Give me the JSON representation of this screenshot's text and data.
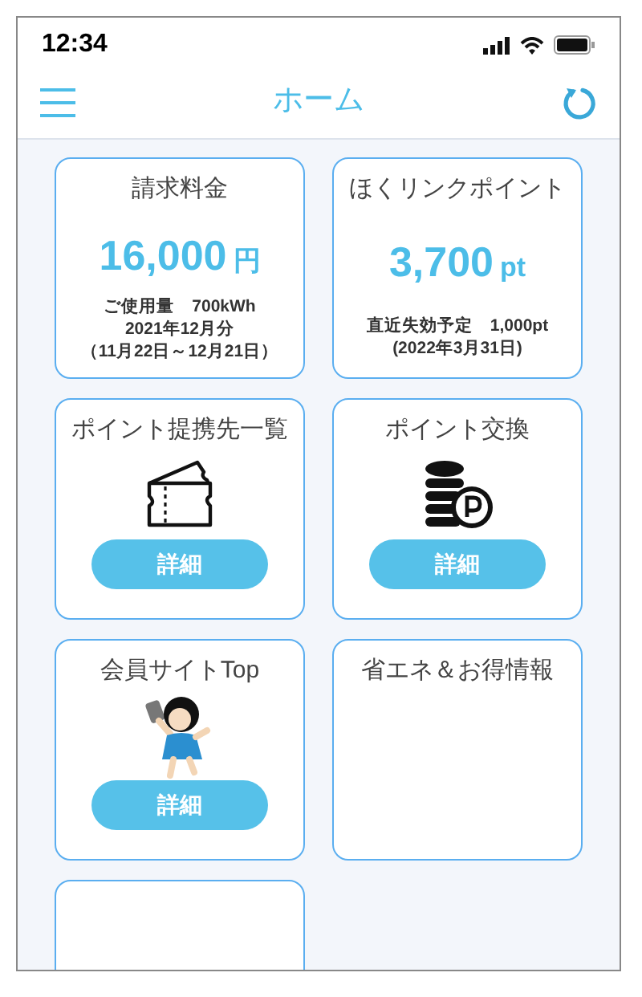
{
  "status_bar": {
    "time": "12:34"
  },
  "header": {
    "title": "ホーム"
  },
  "cards": [
    {
      "kind": "bill",
      "title": "請求料金",
      "amount": "16,000",
      "unit": "円",
      "lines": [
        "ご使用量　700kWh",
        "2021年12月分",
        "（11月22日～12月21日）"
      ]
    },
    {
      "kind": "points",
      "title": "ほくリンクポイント",
      "amount": "3,700",
      "unit": "pt",
      "lines": [
        "直近失効予定　1,000pt",
        "(2022年3月31日)"
      ]
    },
    {
      "kind": "ticket",
      "title": "ポイント提携先一覧",
      "button": "詳細"
    },
    {
      "kind": "coins",
      "title": "ポイント交換",
      "button": "詳細"
    },
    {
      "kind": "figure",
      "title": "会員サイトTop",
      "button": "詳細"
    },
    {
      "kind": "info",
      "title": "省エネ＆お得情報"
    },
    {
      "kind": "blank"
    }
  ]
}
